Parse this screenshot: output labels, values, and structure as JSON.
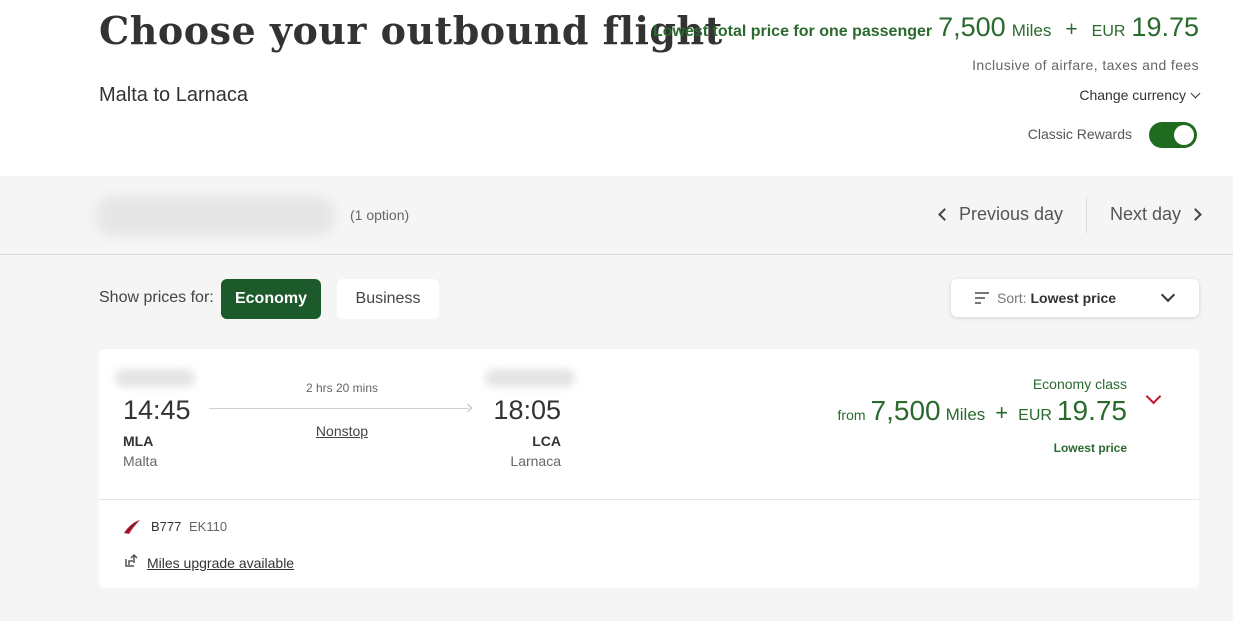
{
  "header": {
    "title": "Choose your outbound flight",
    "route": "Malta to Larnaca",
    "lowest_label": "Lowest total price for one passenger",
    "lowest_miles": "7,500",
    "miles_unit": "Miles",
    "plus": "+",
    "currency": "EUR",
    "lowest_amount": "19.75",
    "inclusive_note": "Inclusive of airfare, taxes and fees",
    "change_currency": "Change currency",
    "classic_rewards_label": "Classic Rewards",
    "classic_rewards_on": true
  },
  "date_bar": {
    "options_count": "(1 option)",
    "previous_day": "Previous day",
    "next_day": "Next day"
  },
  "filters": {
    "show_prices_label": "Show prices for:",
    "cabins": [
      "Economy",
      "Business"
    ],
    "selected_cabin": "Economy",
    "sort_label": "Sort:",
    "sort_value": "Lowest price"
  },
  "flight": {
    "departure_time": "14:45",
    "departure_code": "MLA",
    "departure_city": "Malta",
    "arrival_time": "18:05",
    "arrival_code": "LCA",
    "arrival_city": "Larnaca",
    "duration": "2 hrs 20 mins",
    "stops": "Nonstop",
    "fare_class": "Economy class",
    "fare_from": "from",
    "fare_miles": "7,500",
    "fare_miles_unit": "Miles",
    "fare_plus": "+",
    "fare_currency": "EUR",
    "fare_amount": "19.75",
    "fare_tag": "Lowest price",
    "aircraft": "B777",
    "flight_number": "EK110",
    "upgrade_text": "Miles upgrade available"
  },
  "colors": {
    "brand_green": "#1d5a2b",
    "price_green": "#2a6a2e",
    "toggle_green": "#1f6b1f",
    "accent_red": "#c8102e",
    "background_grey": "#f5f5f5"
  }
}
